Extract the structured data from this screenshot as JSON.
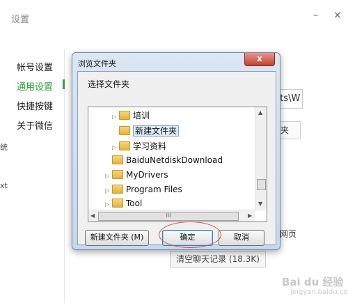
{
  "settings": {
    "title": "设置",
    "minimize": "–",
    "close": "×",
    "sidebar": [
      {
        "label": "帐号设置",
        "active": false
      },
      {
        "label": "通用设置",
        "active": true
      },
      {
        "label": "快捷按键",
        "active": false
      },
      {
        "label": "关于微信",
        "active": false
      }
    ],
    "cut_left_1": "统",
    "cut_left_2": "xt",
    "path_field_value": "nts\\W",
    "change_folder_button": "件夹",
    "open_web_label": "网页",
    "clear_history_button": "清空聊天记录 (18.3K)"
  },
  "dialog": {
    "title": "浏览文件夹",
    "close_label": "x",
    "prompt": "选择文件夹",
    "tree": [
      {
        "label": "培训",
        "arrow": "▷",
        "indent": 2,
        "selected": false
      },
      {
        "label": "新建文件夹",
        "arrow": "",
        "indent": 2,
        "selected": true
      },
      {
        "label": "学习资料",
        "arrow": "▷",
        "indent": 2,
        "selected": false
      },
      {
        "label": "BaiduNetdiskDownload",
        "arrow": "",
        "indent": 1,
        "selected": false
      },
      {
        "label": "MyDrivers",
        "arrow": "▷",
        "indent": 1,
        "selected": false
      },
      {
        "label": "Program Files",
        "arrow": "▷",
        "indent": 1,
        "selected": false
      },
      {
        "label": "Tool",
        "arrow": "▷",
        "indent": 1,
        "selected": false
      }
    ],
    "hscroll_grip": "III",
    "new_folder_button": "新建文件夹 (M)",
    "ok_button": "确定",
    "cancel_button": "取消"
  },
  "watermark": {
    "text": "Bai du 经验",
    "sub": "jingyan.baidu.com"
  }
}
